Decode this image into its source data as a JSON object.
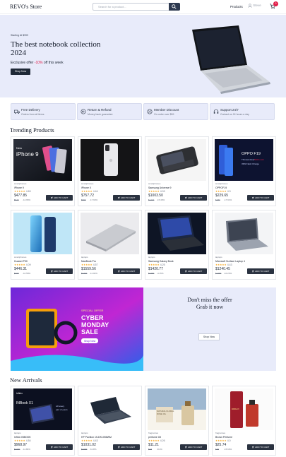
{
  "header": {
    "logo": "REVO's Store",
    "search_placeholder": "Search for a product...",
    "nav_products": "Products",
    "nav_user": "Steve",
    "cart_count": "0"
  },
  "hero": {
    "eyebrow": "Starting At $999",
    "title": "The best notebook collection 2024",
    "subtitle_prefix": "Exclusive offer ",
    "subtitle_discount": "-10%",
    "subtitle_suffix": " off this week",
    "button": "Shop Now"
  },
  "features": [
    {
      "title": "Free Delivery",
      "subtitle": "Orders from all items"
    },
    {
      "title": "Return & Refund",
      "subtitle": "Money back guarantee"
    },
    {
      "title": "Member Discount",
      "subtitle": "On order over $99"
    },
    {
      "title": "Support 24/7",
      "subtitle": "Contact us 24 hours a day"
    }
  ],
  "trending_title": "Trending Products",
  "trending": [
    {
      "category": "smartphones",
      "name": "iPhone 9",
      "stars": "★★★★★",
      "rating": "4.69",
      "price": "$477.85",
      "old_price": "$549",
      "discount": "-12.96%",
      "button": "ADD TO CART",
      "image_text": [
        "New",
        "iPhone 9"
      ]
    },
    {
      "category": "smartphones",
      "name": "iPhone X",
      "stars": "★★★★★",
      "rating": "4.44",
      "price": "$757.72",
      "old_price": "$899",
      "discount": "-17.94%",
      "button": "ADD TO CART",
      "image_text": []
    },
    {
      "category": "smartphones",
      "name": "Samsung Universe 9",
      "stars": "★★★★★",
      "rating": "4.09",
      "price": "$1003.50",
      "old_price": "$1249",
      "discount": "-15.46%",
      "button": "ADD TO CART",
      "image_text": []
    },
    {
      "category": "smartphones",
      "name": "OPPOF19",
      "stars": "★★★★★",
      "rating": "4.3",
      "price": "$229.65",
      "old_price": "$280",
      "discount": "-17.91%",
      "button": "ADD TO CART",
      "image_text": [
        "OPPO F19",
        "Thinnest Ever",
        "5000 mAh",
        "33W Flash Charge"
      ]
    },
    {
      "category": "smartphones",
      "name": "Huawei P30",
      "stars": "★★★★★",
      "rating": "4.09",
      "price": "$446.31",
      "old_price": "$499",
      "discount": "-10.58%",
      "button": "ADD TO CART",
      "image_text": []
    },
    {
      "category": "laptops",
      "name": "MacBook Pro",
      "stars": "★★★★★",
      "rating": "4.57",
      "price": "$1559.56",
      "old_price": "$1749",
      "discount": "-11.02%",
      "button": "ADD TO CART",
      "image_text": []
    },
    {
      "category": "laptops",
      "name": "Samsung Galaxy Book",
      "stars": "★★★★★",
      "rating": "4.25",
      "price": "$1420.77",
      "old_price": "$1499",
      "discount": "-4.15%",
      "button": "ADD TO CART",
      "image_text": []
    },
    {
      "category": "laptops",
      "name": "Microsoft Surface Laptop 4",
      "stars": "★★★★★",
      "rating": "4.43",
      "price": "$1240.45",
      "old_price": "$1499",
      "discount": "-10.23%",
      "button": "ADD TO CART",
      "image_text": []
    }
  ],
  "promo": {
    "title_line1": "Don't miss the offer",
    "title_line2": "Grab it now",
    "button": "Shop Now",
    "image_small": "SPECIAL OFFER",
    "image_line1": "CYBER",
    "image_line2": "MONDAY",
    "image_line3": "SALE",
    "image_button": "Shop Now"
  },
  "arrivals_title": "New Arrivals",
  "arrivals": [
    {
      "category": "laptops",
      "name": "Infinix INBOOK",
      "stars": "★★★★★",
      "rating": "4.54",
      "price": "$968.97",
      "old_price": "$1099",
      "discount": "-11.83%",
      "button": "ADD TO CART",
      "image_text": [
        "infinix",
        "INBook X1",
        "Lift every",
        "part of yours"
      ]
    },
    {
      "category": "laptops",
      "name": "HP Pavilion 15-DK1056WM",
      "stars": "★★★★★",
      "rating": "4.43",
      "price": "$1031.02",
      "old_price": "$1099",
      "discount": "-6.18%",
      "button": "ADD TO CART",
      "image_text": []
    },
    {
      "category": "fragrances",
      "name": "perfume Oil",
      "stars": "★★★★★",
      "rating": "4.26",
      "price": "$11.21",
      "old_price": "$13",
      "discount": "-8.4%",
      "button": "ADD TO CART",
      "image_text": [
        "NATURAL FLORAL",
        "ROSE OIL"
      ]
    },
    {
      "category": "fragrances",
      "name": "Brown Perfume",
      "stars": "★★★★★",
      "rating": "4.0",
      "price": "$25.74",
      "old_price": "$40",
      "discount": "-15.66%",
      "button": "ADD TO CART",
      "image_text": [
        "RIDIAN"
      ]
    }
  ]
}
